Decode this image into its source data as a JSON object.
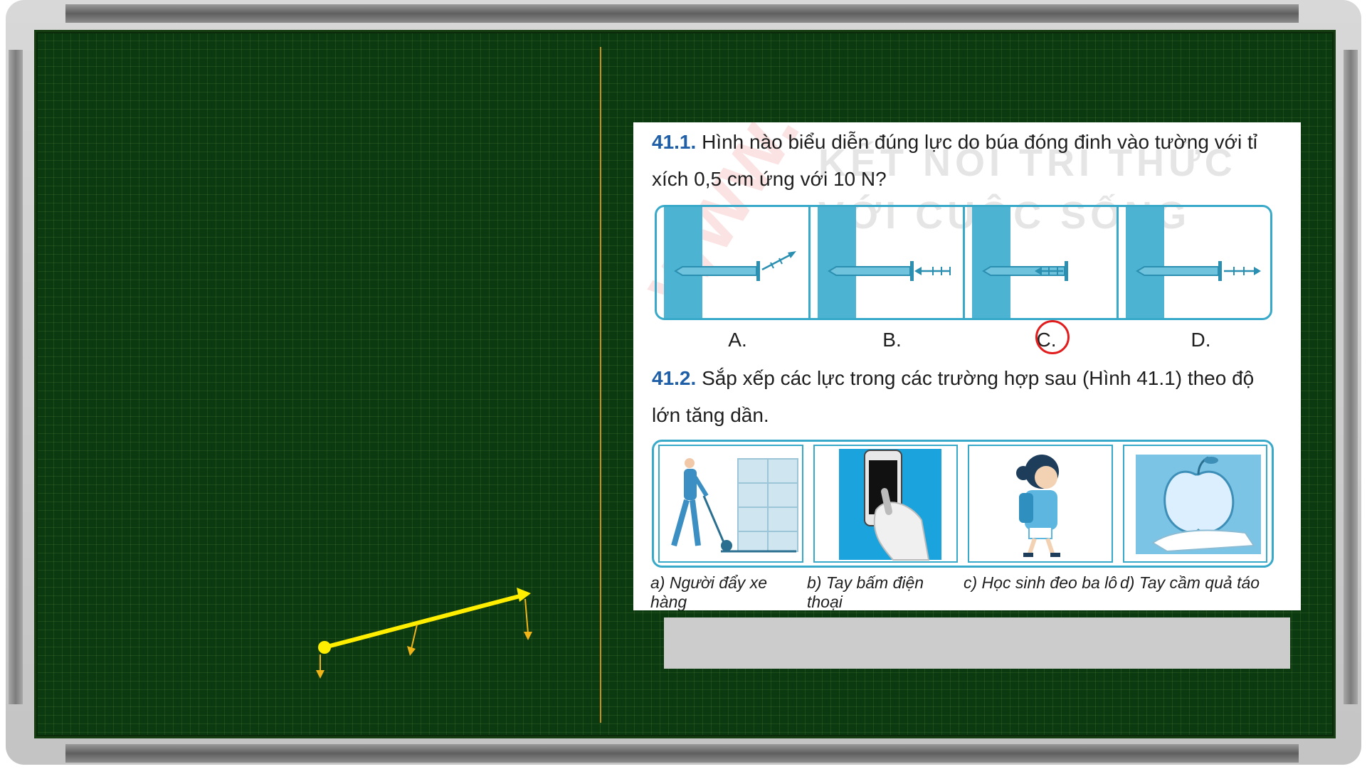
{
  "q1": {
    "number": "41.1.",
    "text": "Hình nào biểu diễn đúng lực do búa đóng đinh vào tường với tỉ xích 0,5 cm ứng với 10 N?",
    "options": [
      "A.",
      "B.",
      "C.",
      "D."
    ],
    "selected": "C."
  },
  "q2": {
    "number": "41.2.",
    "text": "Sắp xếp các lực trong các trường hợp sau (Hình 41.1) theo độ lớn tăng dần.",
    "captions": [
      "a) Người đẩy xe hàng",
      "b) Tay bấm điện thoại",
      "c) Học sinh đeo ba lô",
      "d) Tay cầm quả táo"
    ]
  },
  "watermark": {
    "line1": "KẾT NỐI TRI THỨC",
    "line2": "VỚI CUỘC SỐNG",
    "red": "www.E.Lib"
  },
  "colors": {
    "board": "#0c3a10",
    "accent": "#39a9c9",
    "question_number": "#1f5fa8",
    "vector": "#ffee00",
    "circle": "#e21d1d"
  }
}
